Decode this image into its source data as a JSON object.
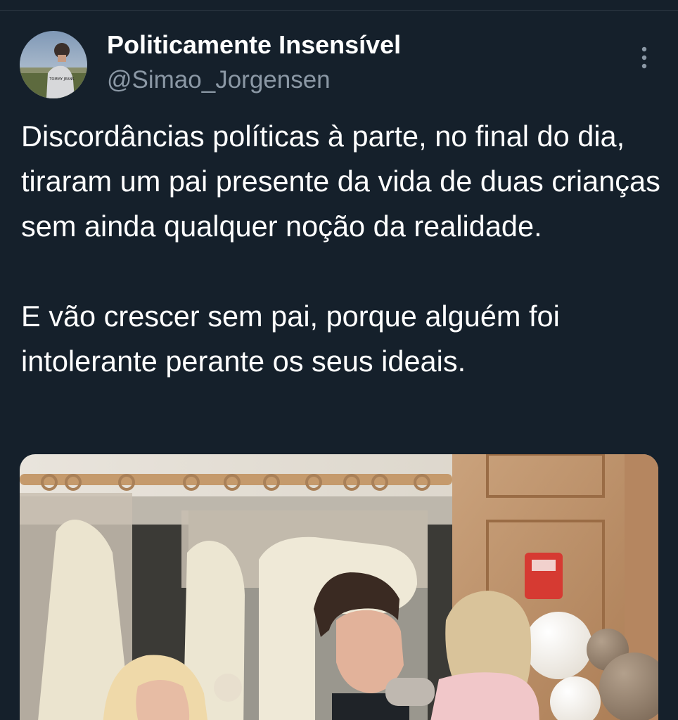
{
  "author": {
    "display_name": "Politicamente Insensível",
    "handle": "@Simao_Jorgensen",
    "avatar_icon": "profile-photo",
    "avatar_hoodie_text": "TOMMY JEANS"
  },
  "menu": {
    "icon": "more-vertical-icon"
  },
  "tweet": {
    "text": "Discordâncias políticas à parte, no final do dia, tiraram um pai presente da vida de duas crianças sem ainda qualquer noção da realidade.\n\nE vão crescer sem pai, porque alguém foi intolerante perante os seus ideais."
  },
  "media": {
    "kind": "photo",
    "icon": "photo-image"
  },
  "colors": {
    "background": "#15202b",
    "text_primary": "#ffffff",
    "text_secondary": "#8b98a5"
  }
}
